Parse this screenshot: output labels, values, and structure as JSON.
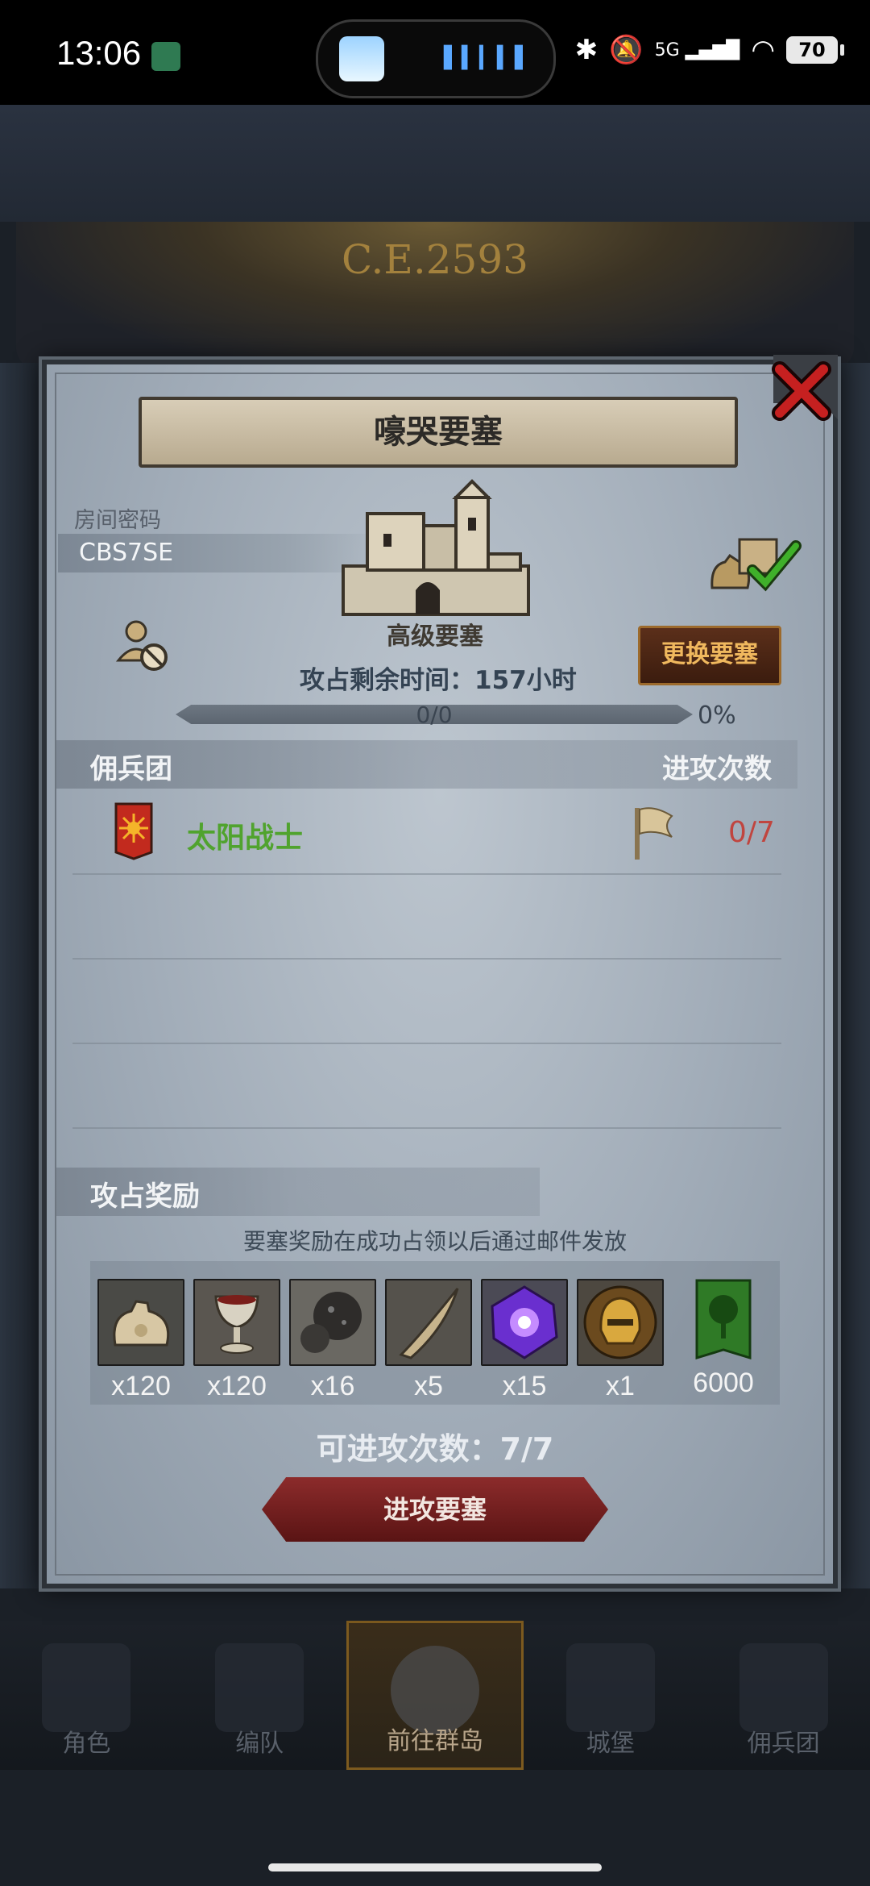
{
  "status_bar": {
    "time": "13:06",
    "network": "5G",
    "battery": "70"
  },
  "background": {
    "era": "C.E.2593"
  },
  "dialog": {
    "title": "嚎哭要塞",
    "room_password_label": "房间密码",
    "room_password": "CBS7SE",
    "fortress_level": "高级要塞",
    "change_fortress": "更换要塞",
    "remaining_time": "攻占剩余时间：157小时",
    "progress_text": "0/0",
    "progress_percent": "0%",
    "progress_fraction": 0,
    "mercenary_header": "佣兵团",
    "attack_count_header": "进攻次数",
    "guild": {
      "name": "太阳战士",
      "attacks": "0/7",
      "color": "#50a32e",
      "attack_color": "#c0453f"
    },
    "rewards_header": "攻占奖励",
    "rewards_note": "要塞奖励在成功占领以后通过邮件发放",
    "rewards": [
      {
        "icon": "pouch-icon",
        "qty": "x120"
      },
      {
        "icon": "goblet-icon",
        "qty": "x120"
      },
      {
        "icon": "ore-icon",
        "qty": "x16"
      },
      {
        "icon": "horn-icon",
        "qty": "x5"
      },
      {
        "icon": "purple-crystal-icon",
        "qty": "x15"
      },
      {
        "icon": "golden-helmet-icon",
        "qty": "x1"
      },
      {
        "icon": "tree-banner-icon",
        "qty": "6000"
      }
    ],
    "available_attacks": "可进攻次数：7/7",
    "attack_button": "进攻要塞"
  },
  "nav": [
    {
      "label": "角色"
    },
    {
      "label": "编队"
    },
    {
      "label": "前往群岛"
    },
    {
      "label": "城堡"
    },
    {
      "label": "佣兵团"
    }
  ]
}
